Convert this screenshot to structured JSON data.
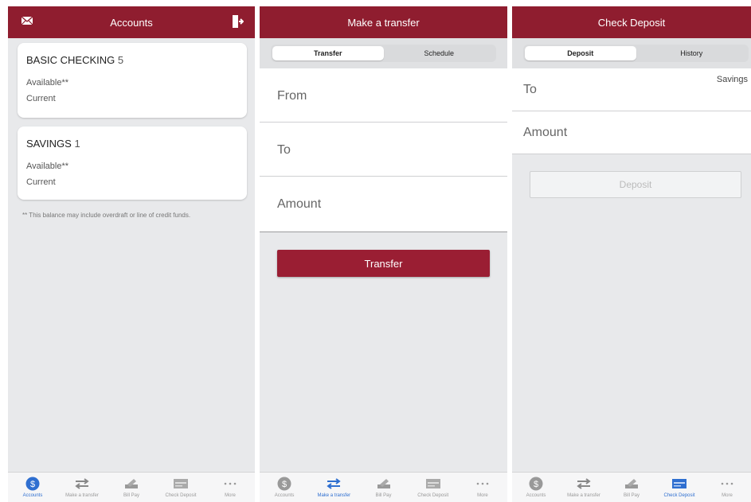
{
  "colors": {
    "brand": "#8f1d2f",
    "button": "#9a1e33",
    "active_tab": "#2f6fd0",
    "inactive_tab": "#9a9a9a"
  },
  "accounts_screen": {
    "title": "Accounts",
    "left_icon": "envelope-icon",
    "right_icon": "logout-icon",
    "cards": [
      {
        "name": "BASIC CHECKING",
        "number": "5",
        "available_label": "Available**",
        "current_label": "Current"
      },
      {
        "name": "SAVINGS",
        "number": "1",
        "available_label": "Available**",
        "current_label": "Current"
      }
    ],
    "footnote": "** This balance may include overdraft or line of credit funds."
  },
  "transfer_screen": {
    "title": "Make a transfer",
    "segments": [
      "Transfer",
      "Schedule"
    ],
    "fields": [
      "From",
      "To",
      "Amount"
    ],
    "button": "Transfer"
  },
  "deposit_screen": {
    "title": "Check Deposit",
    "segments": [
      "Deposit",
      "History"
    ],
    "fields": [
      {
        "label": "To",
        "value": "Savings"
      },
      {
        "label": "Amount",
        "value": ""
      }
    ],
    "button": "Deposit"
  },
  "tabbar": {
    "items": [
      {
        "label": "Accounts",
        "icon": "dollar-circle-icon"
      },
      {
        "label": "Make a transfer",
        "icon": "transfer-arrows-icon"
      },
      {
        "label": "Bill Pay",
        "icon": "check-pen-icon"
      },
      {
        "label": "Check Deposit",
        "icon": "check-card-icon"
      },
      {
        "label": "More",
        "icon": "more-dots-icon"
      }
    ]
  }
}
